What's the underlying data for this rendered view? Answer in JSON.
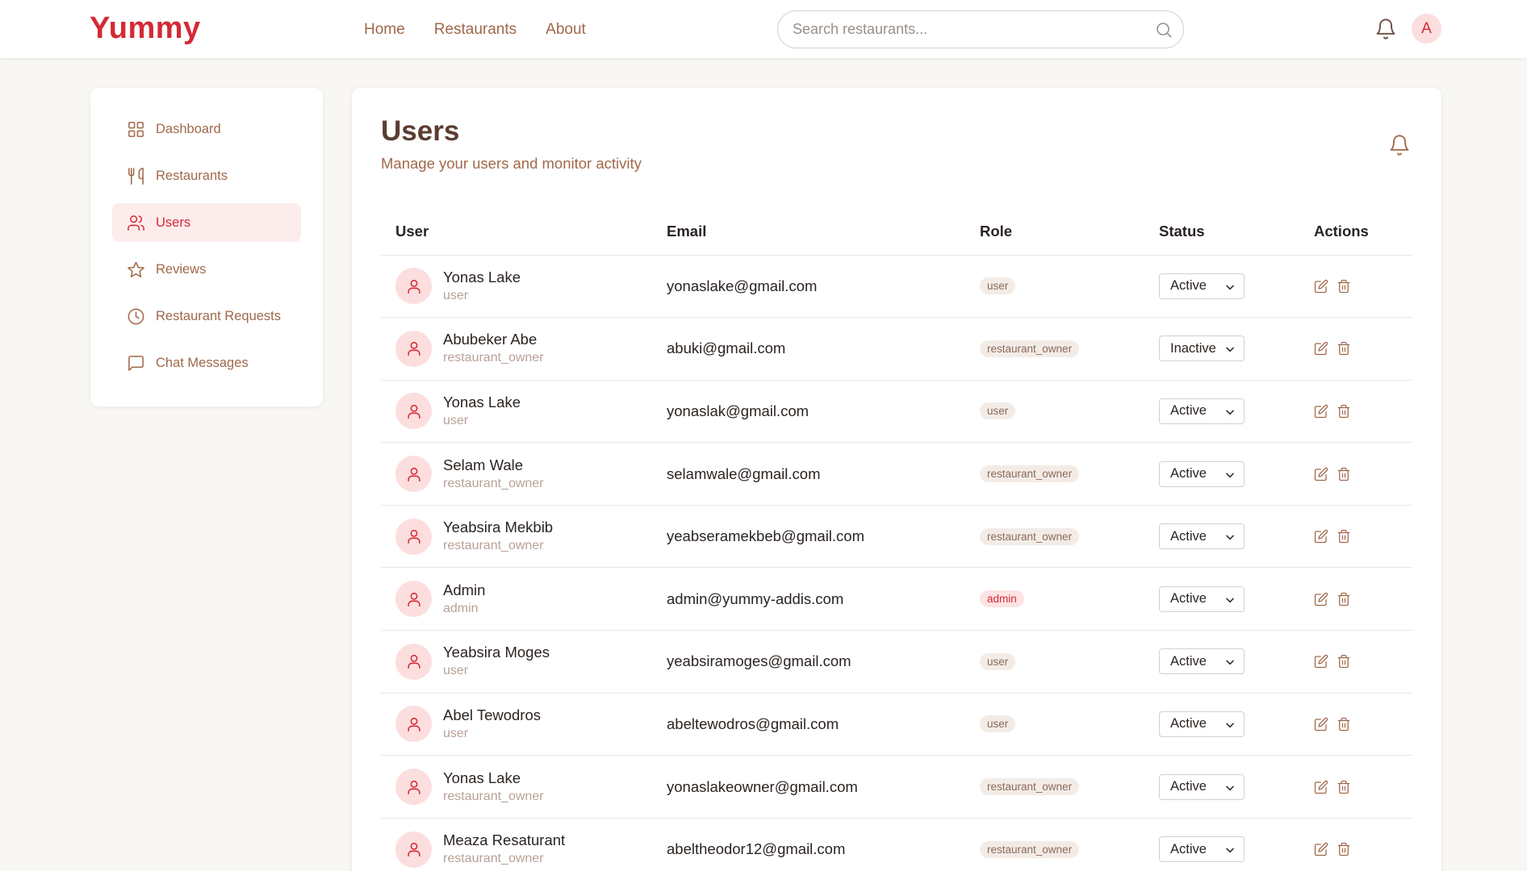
{
  "header": {
    "logo": "Yummy",
    "nav": [
      "Home",
      "Restaurants",
      "About"
    ],
    "search_placeholder": "Search restaurants...",
    "avatar_initial": "A"
  },
  "sidebar": {
    "items": [
      {
        "label": "Dashboard",
        "icon": "dashboard-grid-icon"
      },
      {
        "label": "Restaurants",
        "icon": "utensils-icon"
      },
      {
        "label": "Users",
        "icon": "users-icon",
        "active": true
      },
      {
        "label": "Reviews",
        "icon": "star-icon"
      },
      {
        "label": "Restaurant Requests",
        "icon": "clock-icon"
      },
      {
        "label": "Chat Messages",
        "icon": "chat-bubble-icon"
      }
    ]
  },
  "main": {
    "title": "Users",
    "subtitle": "Manage your users and monitor activity",
    "columns": [
      "User",
      "Email",
      "Role",
      "Status",
      "Actions"
    ],
    "users": [
      {
        "name": "Yonas Lake",
        "sub": "user",
        "email": "yonaslake@gmail.com",
        "role": "user",
        "status": "Active"
      },
      {
        "name": "Abubeker Abe",
        "sub": "restaurant_owner",
        "email": "abuki@gmail.com",
        "role": "restaurant_owner",
        "status": "Inactive"
      },
      {
        "name": "Yonas Lake",
        "sub": "user",
        "email": "yonaslak@gmail.com",
        "role": "user",
        "status": "Active"
      },
      {
        "name": "Selam Wale",
        "sub": "restaurant_owner",
        "email": "selamwale@gmail.com",
        "role": "restaurant_owner",
        "status": "Active"
      },
      {
        "name": "Yeabsira Mekbib",
        "sub": "restaurant_owner",
        "email": "yeabseramekbeb@gmail.com",
        "role": "restaurant_owner",
        "status": "Active"
      },
      {
        "name": "Admin",
        "sub": "admin",
        "email": "admin@yummy-addis.com",
        "role": "admin",
        "status": "Active"
      },
      {
        "name": "Yeabsira Moges",
        "sub": "user",
        "email": "yeabsiramoges@gmail.com",
        "role": "user",
        "status": "Active"
      },
      {
        "name": "Abel Tewodros",
        "sub": "user",
        "email": "abeltewodros@gmail.com",
        "role": "user",
        "status": "Active"
      },
      {
        "name": "Yonas Lake",
        "sub": "restaurant_owner",
        "email": "yonaslakeowner@gmail.com",
        "role": "restaurant_owner",
        "status": "Active"
      },
      {
        "name": "Meaza Resaturant",
        "sub": "restaurant_owner",
        "email": "abeltheodor12@gmail.com",
        "role": "restaurant_owner",
        "status": "Active"
      }
    ]
  },
  "colors": {
    "brand": "#d42a35",
    "accent_text": "#a0694a",
    "avatar_bg": "#fcdede"
  }
}
